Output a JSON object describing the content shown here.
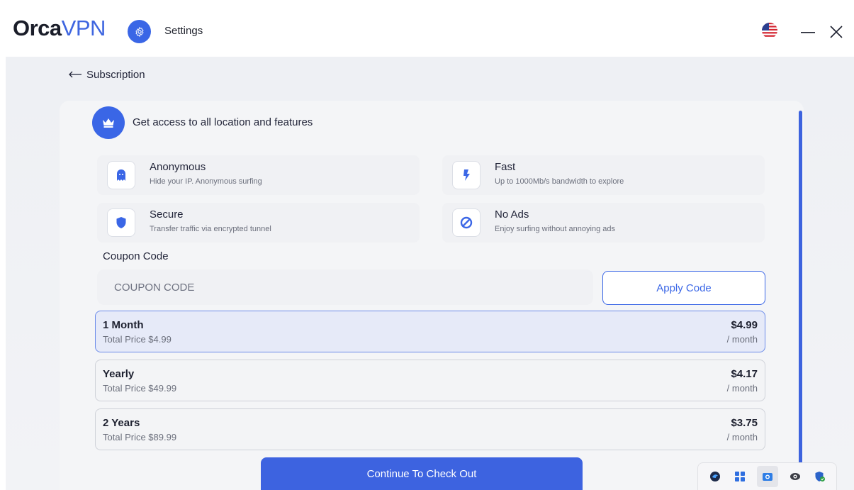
{
  "app": {
    "logo_part1": "Orca",
    "logo_part2": "VPN",
    "settings_label": "Settings",
    "flag_icon": "us-flag-icon"
  },
  "page": {
    "back_label": "Subscription",
    "headline": "Get access to all location and features"
  },
  "features": [
    {
      "title": "Anonymous",
      "desc": "Hide your IP. Anonymous surfing",
      "icon": "ghost-icon"
    },
    {
      "title": "Fast",
      "desc": "Up to 1000Mb/s bandwidth to explore",
      "icon": "lightning-icon"
    },
    {
      "title": "Secure",
      "desc": "Transfer traffic via encrypted tunnel",
      "icon": "shield-icon"
    },
    {
      "title": "No Ads",
      "desc": "Enjoy surfing without annoying ads",
      "icon": "no-ads-icon"
    }
  ],
  "coupon": {
    "label": "Coupon Code",
    "placeholder": "COUPON CODE",
    "value": "",
    "apply_label": "Apply Code"
  },
  "plans": [
    {
      "name": "1 Month",
      "total": "Total Price $4.99",
      "price": "$4.99",
      "per": "/ month",
      "selected": true
    },
    {
      "name": "Yearly",
      "total": "Total Price $49.99",
      "price": "$4.17",
      "per": "/ month",
      "selected": false
    },
    {
      "name": "2 Years",
      "total": "Total Price $89.99",
      "price": "$3.75",
      "per": "/ month",
      "selected": false
    }
  ],
  "checkout_label": "Continue To Check Out",
  "tray_icons": [
    "vpn-tray-icon",
    "grid-tray-icon",
    "camera-tray-icon",
    "eye-tray-icon",
    "defender-tray-icon"
  ],
  "colors": {
    "accent": "#3a66e6",
    "selected_plan_bg": "#e6eaf8"
  }
}
